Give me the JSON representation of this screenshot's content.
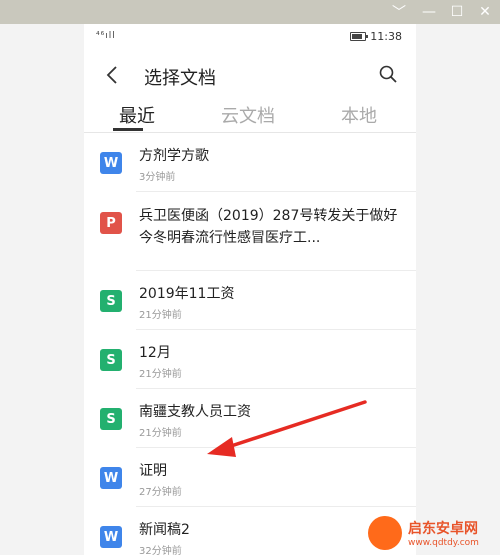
{
  "window": {
    "controls": [
      "﹀",
      "—",
      "☐",
      "✕"
    ]
  },
  "status_bar": {
    "signal": "⁴⁶ıll",
    "battery_level": 0.8,
    "time": "11:38"
  },
  "header": {
    "title": "选择文档"
  },
  "tabs": [
    {
      "label": "最近",
      "active": true
    },
    {
      "label": "云文档",
      "active": false
    },
    {
      "label": "本地",
      "active": false
    }
  ],
  "files": [
    {
      "type": "word",
      "icon_letter": "W",
      "name": "方剂学方歌",
      "time": "3分钟前"
    },
    {
      "type": "pdf",
      "icon_letter": "P",
      "name": "兵卫医便函（2019）287号转发关于做好今冬明春流行性感冒医疗工...",
      "time": ""
    },
    {
      "type": "sheet",
      "icon_letter": "S",
      "name": "2019年11工资",
      "time": "21分钟前"
    },
    {
      "type": "sheet",
      "icon_letter": "S",
      "name": "12月",
      "time": "21分钟前"
    },
    {
      "type": "sheet",
      "icon_letter": "S",
      "name": "南疆支教人员工资",
      "time": "21分钟前"
    },
    {
      "type": "word",
      "icon_letter": "W",
      "name": "证明",
      "time": "27分钟前"
    },
    {
      "type": "word",
      "icon_letter": "W",
      "name": "新闻稿2",
      "time": "32分钟前"
    }
  ],
  "colors": {
    "word": "#3f85ea",
    "pdf": "#e15349",
    "sheet": "#23b06f",
    "arrow": "#e62b23"
  },
  "watermark": {
    "name": "启东安卓网",
    "url": "www.qdtdy.com"
  }
}
